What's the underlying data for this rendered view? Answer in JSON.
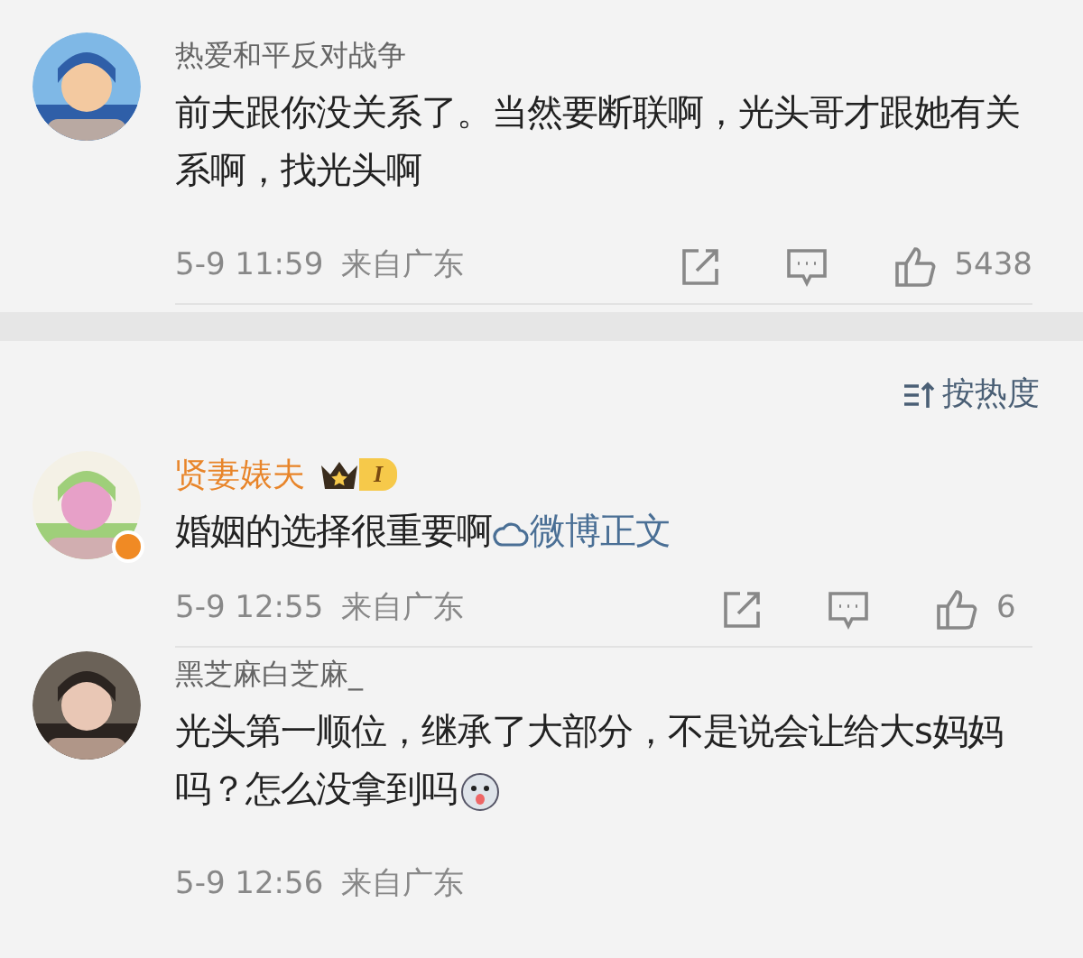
{
  "comments": [
    {
      "user": "热爱和平反对战争",
      "kind": "normal",
      "verified": false,
      "text": "前夫跟你没关系了。当然要断联啊，光头哥才跟她有关系啊，找光头啊",
      "emoji": false,
      "time": "5-9 11:59",
      "location": "来自广东",
      "likes": "5438"
    },
    {
      "user": "贤妻婊夫",
      "kind": "vip",
      "badge": "I",
      "verified": true,
      "text": "婚姻的选择很重要啊",
      "link": "微博正文",
      "emoji": false,
      "time": "5-9 12:55",
      "location": "来自广东",
      "likes": "6"
    },
    {
      "user": "黑芝麻白芝麻_",
      "kind": "normal",
      "verified": false,
      "text": "光头第一顺位，继承了大部分，不是说会让给大s妈妈吗？怎么没拿到吗",
      "emoji": true,
      "time": "5-9 12:56",
      "location": "来自广东"
    }
  ],
  "sort": {
    "label": "按热度"
  }
}
